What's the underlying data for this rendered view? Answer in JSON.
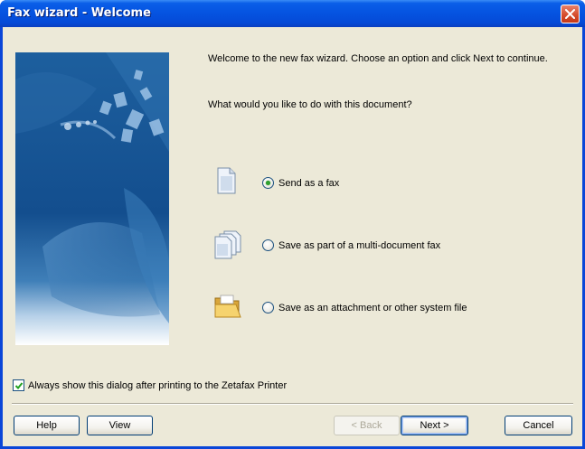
{
  "window": {
    "title": "Fax wizard - Welcome"
  },
  "intro_text": "Welcome to the new fax wizard. Choose an option and click Next to continue.",
  "question_text": "What would you like to do with this document?",
  "options": [
    {
      "label": "Send as a fax",
      "icon": "page-icon",
      "selected": true
    },
    {
      "label": "Save as part of a multi-document fax",
      "icon": "multi-page-icon",
      "selected": false
    },
    {
      "label": "Save as an attachment or other system file",
      "icon": "folder-icon",
      "selected": false
    }
  ],
  "always_show": {
    "label": "Always show this dialog after printing to the Zetafax Printer",
    "checked": true
  },
  "buttons": {
    "help": "Help",
    "view": "View",
    "back": "< Back",
    "next": "Next >",
    "cancel": "Cancel"
  },
  "colors": {
    "titlebar": "#0553e0",
    "dialog_bg": "#ece9d8",
    "radio_dot": "#2fa02f"
  }
}
